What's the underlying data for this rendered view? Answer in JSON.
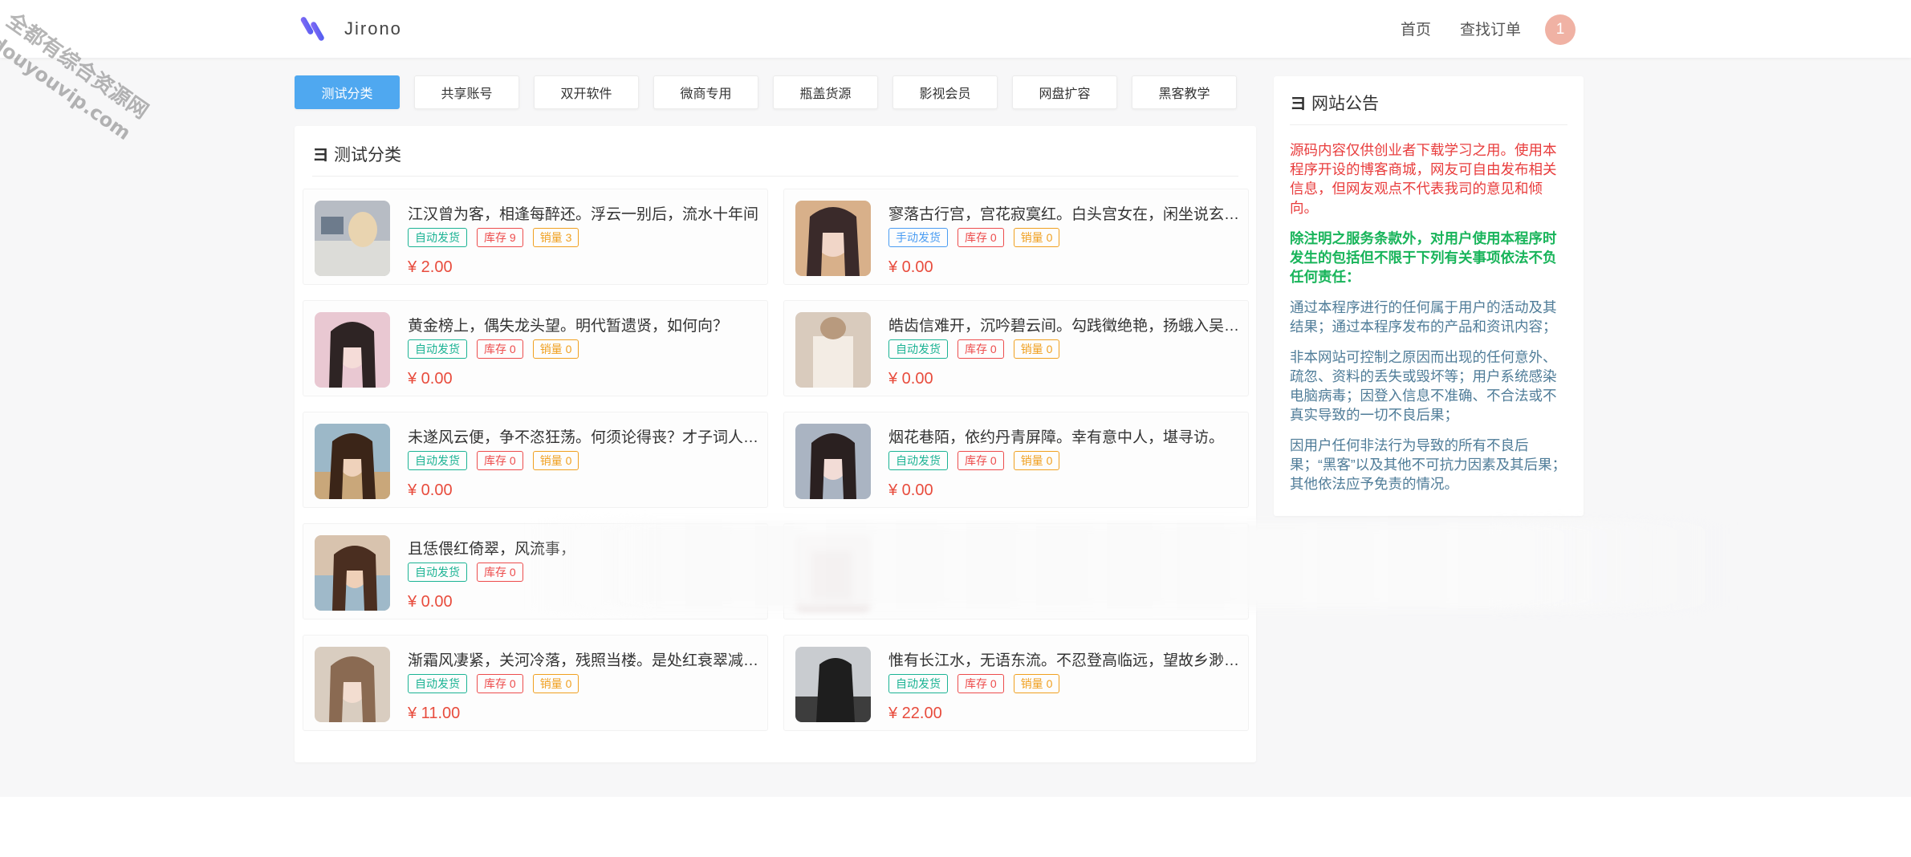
{
  "header": {
    "logo_text": "Jirono",
    "nav": {
      "home": "首页",
      "order": "查找订单"
    },
    "avatar_text": "1"
  },
  "watermark": {
    "line1": "全都有综合资源网",
    "line2": "douyouvip.com"
  },
  "tabs": [
    {
      "label": "测试分类",
      "active": true
    },
    {
      "label": "共享账号",
      "active": false
    },
    {
      "label": "双开软件",
      "active": false
    },
    {
      "label": "微商专用",
      "active": false
    },
    {
      "label": "瓶盖货源",
      "active": false
    },
    {
      "label": "影视会员",
      "active": false
    },
    {
      "label": "网盘扩容",
      "active": false
    },
    {
      "label": "黑客教学",
      "active": false
    }
  ],
  "main": {
    "title": "测试分类",
    "goods": [
      {
        "name": "江汉曾为客，相逢每醉还。浮云一别后，流水十年间",
        "delivery": "自动发货",
        "stock": "库存 9",
        "sales": "销量 3",
        "price": "¥ 2.00"
      },
      {
        "name": "寥落古行宫，宫花寂寞红。白头宫女在，闲坐说玄宗。",
        "delivery": "手动发货",
        "stock": "库存 0",
        "sales": "销量 0",
        "price": "¥ 0.00"
      },
      {
        "name": "黄金榜上，偶失龙头望。明代暂遗贤，如何向？",
        "delivery": "自动发货",
        "stock": "库存 0",
        "sales": "销量 0",
        "price": "¥ 0.00"
      },
      {
        "name": "皓齿信难开，沉吟碧云间。勾践徵绝艳，扬蛾入吴关。",
        "delivery": "自动发货",
        "stock": "库存 0",
        "sales": "销量 0",
        "price": "¥ 0.00"
      },
      {
        "name": "未遂风云便，争不恣狂荡。何须论得丧？才子词人，自…",
        "delivery": "自动发货",
        "stock": "库存 0",
        "sales": "销量 0",
        "price": "¥ 0.00"
      },
      {
        "name": "烟花巷陌，依约丹青屏障。幸有意中人，堪寻访。",
        "delivery": "自动发货",
        "stock": "库存 0",
        "sales": "销量 0",
        "price": "¥ 0.00"
      },
      {
        "name": "且恁偎红倚翠，风流事，",
        "delivery": "自动发货",
        "stock": "库存 0",
        "sales": "",
        "price": "¥ 0.00"
      },
      {
        "name": "",
        "delivery": "",
        "stock": "",
        "sales": "",
        "price": ""
      },
      {
        "name": "渐霜风凄紧，关河冷落，残照当楼。是处红衰翠减，苒…",
        "delivery": "自动发货",
        "stock": "库存 0",
        "sales": "销量 0",
        "price": "¥ 11.00"
      },
      {
        "name": "惟有长江水，无语东流。不忍登高临远，望故乡渺邈…",
        "delivery": "自动发货",
        "stock": "库存 0",
        "sales": "销量 0",
        "price": "¥ 22.00"
      }
    ]
  },
  "notice": {
    "title": "网站公告",
    "p1": "源码内容仅供创业者下载学习之用。使用本程序开设的博客商城，网友可自由发布相关信息，但网友观点不代表我司的意见和倾向。",
    "p2": "除注明之服务条款外，对用户使用本程序时发生的包括但不限于下列有关事项依法不负任何责任：",
    "p3": "通过本程序进行的任何属于用户的活动及其结果；通过本程序发布的产品和资讯内容；",
    "p4": "非本网站可控制之原因而出现的任何意外、疏忽、资料的丢失或毁坏等；用户系统感染电脑病毒；因登入信息不准确、不合法或不真实导致的一切不良后果；",
    "p5": "因用户任何非法行为导致的所有不良后果；“黑客”以及其他不可抗力因素及其后果；其他依法应予免责的情况。"
  },
  "colors": {
    "accent": "#4fa8f0",
    "price": "#e84c3d",
    "auto": "#1bb394",
    "manual": "#4a9cf2",
    "stock": "#ed4c4c",
    "sales": "#f0a020",
    "logo": "#6a5cf0"
  }
}
